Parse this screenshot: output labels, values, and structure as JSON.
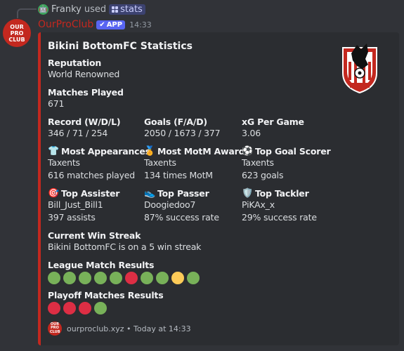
{
  "reply": {
    "user": "Franky",
    "verb": "used",
    "command": "stats"
  },
  "message": {
    "avatar_text": "OUR PRO CLUB",
    "username": "OurProClub",
    "badge": "APP",
    "timestamp": "14:33"
  },
  "embed": {
    "accent_color": "#c3281f",
    "title": "Bikini BottomFC Statistics",
    "reputation": {
      "label": "Reputation",
      "value": "World Renowned"
    },
    "matches_played": {
      "label": "Matches Played",
      "value": "671"
    },
    "record": {
      "label": "Record (W/D/L)",
      "value": "346 / 71 / 254"
    },
    "goals": {
      "label": "Goals (F/A/D)",
      "value": "2050 / 1673 / 377"
    },
    "xg": {
      "label": "xG Per Game",
      "value": "3.06"
    },
    "most_appearances": {
      "icon": "shirt-icon",
      "label": "Most Appearances",
      "player": "Taxents",
      "detail": "616 matches played"
    },
    "most_motm": {
      "icon": "medal-icon",
      "label": "Most MotM Awards",
      "player": "Taxents",
      "detail": "134 times MotM"
    },
    "top_scorer": {
      "icon": "football-icon",
      "label": "Top Goal Scorer",
      "player": "Taxents",
      "detail": "623 goals"
    },
    "top_assister": {
      "icon": "target-icon",
      "label": "Top Assister",
      "player": "Bill_Just_Bill1",
      "detail": "397 assists"
    },
    "top_passer": {
      "icon": "boot-icon",
      "label": "Top Passer",
      "player": "Doogiedoo7",
      "detail": "87% success rate"
    },
    "top_tackler": {
      "icon": "shield-icon",
      "label": "Top Tackler",
      "player": "PiKAx_x",
      "detail": "29% success rate"
    },
    "win_streak": {
      "label": "Current Win Streak",
      "value": "Bikini BottomFC is on a 5 win streak"
    },
    "league_results": {
      "label": "League Match Results",
      "results": [
        "win",
        "win",
        "win",
        "win",
        "win",
        "loss",
        "win",
        "win",
        "draw",
        "win"
      ]
    },
    "playoff_results": {
      "label": "Playoff Matches Results",
      "results": [
        "loss",
        "loss",
        "loss",
        "win"
      ]
    },
    "result_colors": {
      "win": "#78b159",
      "loss": "#dd2e44",
      "draw": "#fdcb58"
    },
    "footer": {
      "icon_text": "OUR PRO CLUB",
      "text": "ourproclub.xyz • Today at 14:33"
    }
  }
}
